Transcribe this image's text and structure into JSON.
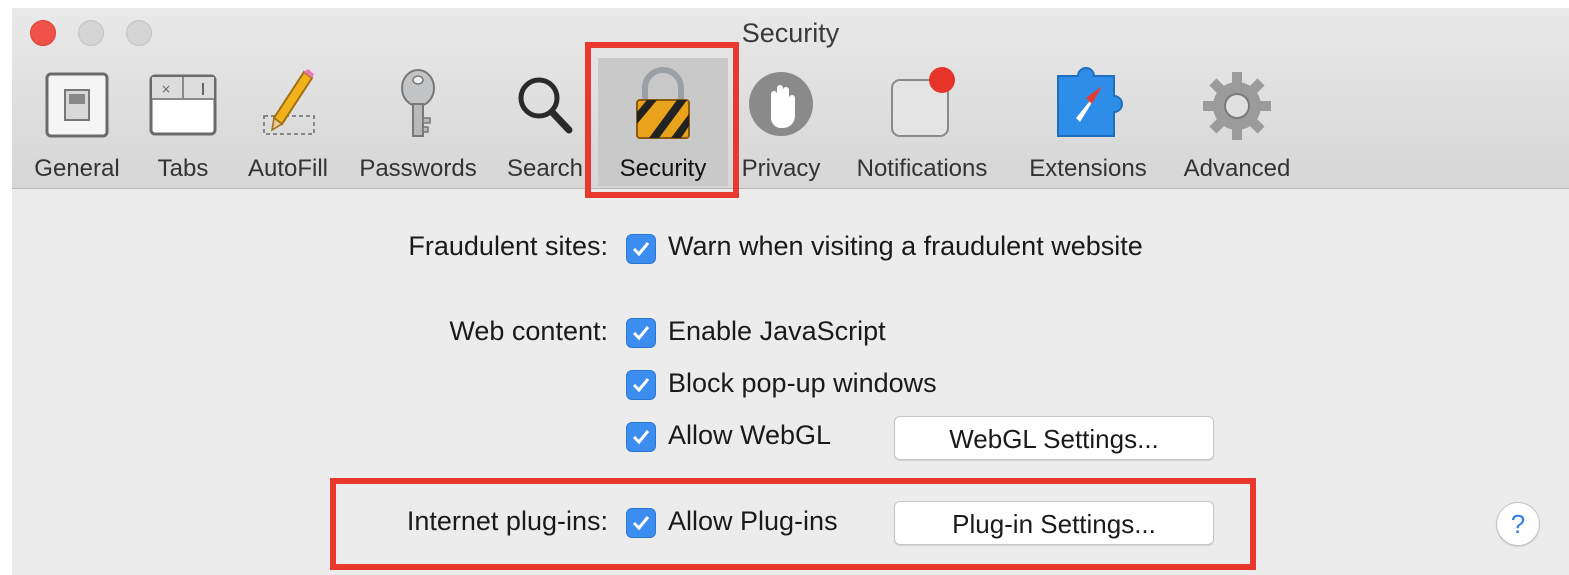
{
  "window": {
    "title": "Security",
    "controls": [
      "close",
      "minimize",
      "zoom"
    ]
  },
  "toolbar": {
    "selected": "Security",
    "tabs": [
      {
        "label": "General",
        "icon": "general-switch-icon"
      },
      {
        "label": "Tabs",
        "icon": "tabs-icon"
      },
      {
        "label": "AutoFill",
        "icon": "pencil-icon"
      },
      {
        "label": "Passwords",
        "icon": "key-icon"
      },
      {
        "label": "Search",
        "icon": "search-icon"
      },
      {
        "label": "Security",
        "icon": "lock-icon"
      },
      {
        "label": "Privacy",
        "icon": "hand-icon"
      },
      {
        "label": "Notifications",
        "icon": "notification-badge-icon"
      },
      {
        "label": "Extensions",
        "icon": "puzzle-compass-icon"
      },
      {
        "label": "Advanced",
        "icon": "gear-icon"
      }
    ]
  },
  "settings": {
    "fraudulent": {
      "label": "Fraudulent sites:",
      "option": "Warn when visiting a fraudulent website",
      "checked": true
    },
    "web_content": {
      "label": "Web content:",
      "options": [
        {
          "text": "Enable JavaScript",
          "checked": true
        },
        {
          "text": "Block pop-up windows",
          "checked": true
        },
        {
          "text": "Allow WebGL",
          "checked": true
        }
      ],
      "webgl_button": "WebGL Settings..."
    },
    "plugins": {
      "label": "Internet plug-ins:",
      "option": "Allow Plug-ins",
      "checked": true,
      "button": "Plug-in Settings..."
    }
  },
  "help": {
    "symbol": "?"
  },
  "colors": {
    "highlight": "#e8392f",
    "checkbox": "#3b8ef0",
    "close": "#f0524a"
  }
}
